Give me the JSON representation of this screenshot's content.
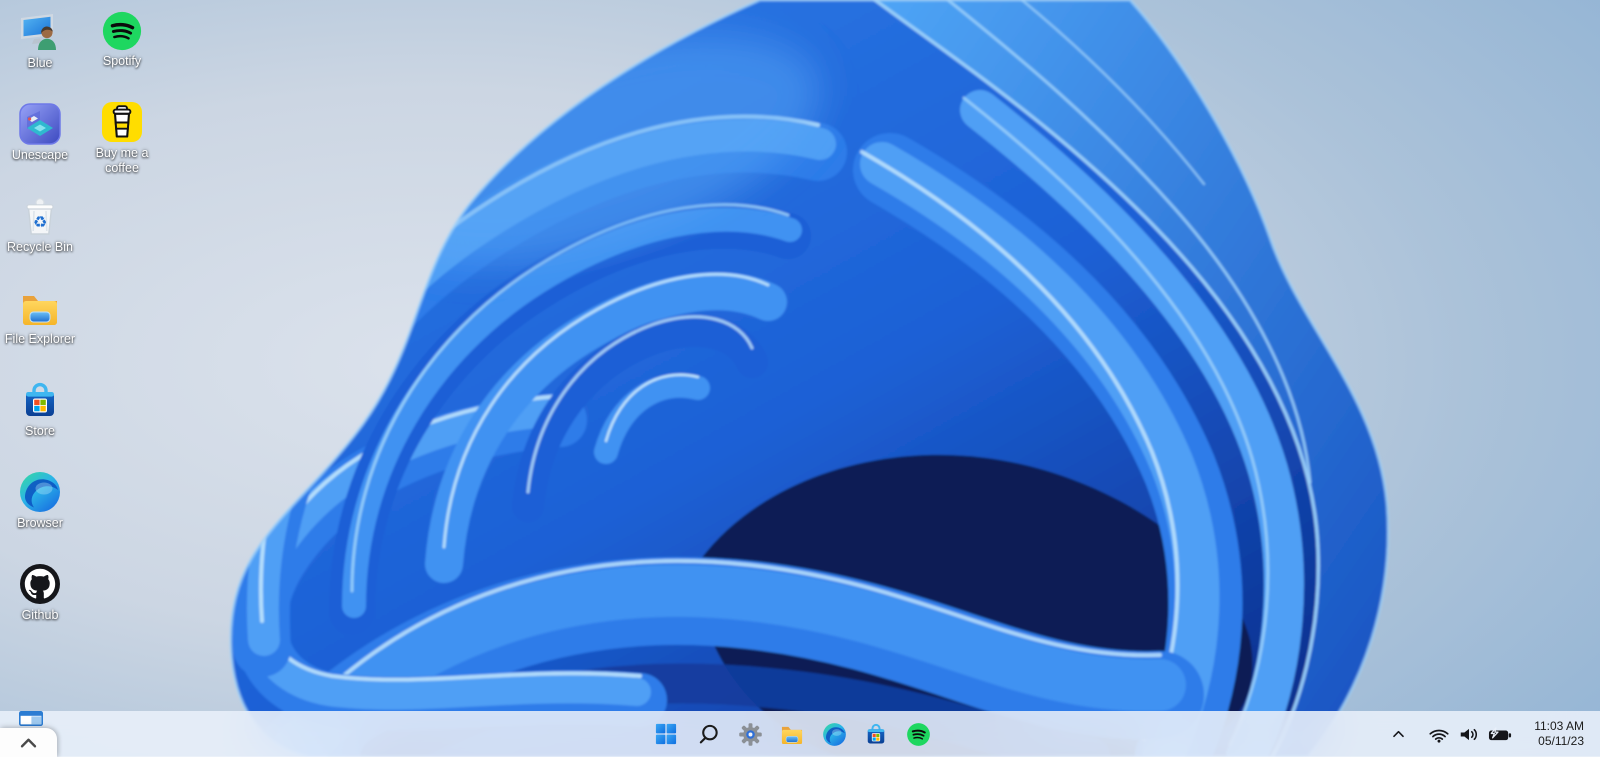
{
  "wallpaper": {
    "description": "Windows 11 blue bloom",
    "accent_blue": "#1d6ae0",
    "deep_blue": "#0a1c55",
    "background_edge": "#8fb2d4",
    "background_light": "#d9e1eb"
  },
  "desktop_icons": [
    {
      "id": "blue",
      "label": "Blue",
      "icon": "user-monitor-icon"
    },
    {
      "id": "spotify",
      "label": "Spotify",
      "icon": "spotify-icon"
    },
    {
      "id": "unescape",
      "label": "Unescape",
      "icon": "unescape-room-icon"
    },
    {
      "id": "coffee",
      "label": "Buy me a coffee",
      "icon": "coffee-cup-icon"
    },
    {
      "id": "recycle-bin",
      "label": "Recycle Bin",
      "icon": "recycle-bin-icon"
    },
    {
      "id": "file-explorer",
      "label": "File Explorer",
      "icon": "folder-icon"
    },
    {
      "id": "store",
      "label": "Store",
      "icon": "store-bag-icon"
    },
    {
      "id": "browser",
      "label": "Browser",
      "icon": "edge-icon"
    },
    {
      "id": "github",
      "label": "Github",
      "icon": "github-icon"
    }
  ],
  "taskbar": {
    "corner": {
      "app_icon": "window-icon",
      "flyout_icon": "chevron-up-icon"
    },
    "center_buttons": [
      {
        "id": "start",
        "icon": "windows-start-icon"
      },
      {
        "id": "search",
        "icon": "search-icon"
      },
      {
        "id": "settings",
        "icon": "gear-icon"
      },
      {
        "id": "file-explorer",
        "icon": "folder-icon"
      },
      {
        "id": "edge",
        "icon": "edge-icon"
      },
      {
        "id": "store",
        "icon": "store-bag-icon"
      },
      {
        "id": "spotify",
        "icon": "spotify-icon"
      }
    ],
    "tray": {
      "hidden_icons": "chevron-up-icon",
      "status_icons": [
        "wifi-icon",
        "volume-icon",
        "battery-charging-icon"
      ],
      "clock": {
        "time": "11:03 AM",
        "date": "05/11/23"
      }
    }
  }
}
